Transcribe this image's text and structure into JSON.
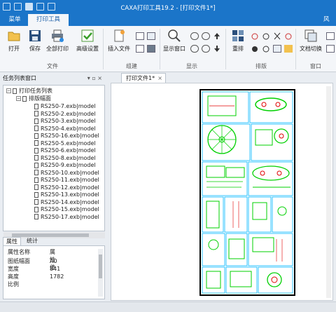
{
  "title": "CAXA打印工具19.2 - [打印文件1*]",
  "tabs": {
    "menu": "菜单",
    "print_tools": "打印工具",
    "style": "风"
  },
  "ribbon": {
    "open": "打开",
    "save": "保存",
    "print_all": "全部打印",
    "advanced": "高级设置",
    "insert_file": "插入文件",
    "show_window": "显示窗口",
    "rearrange": "重排",
    "doc_switch": "文档切换",
    "groups": {
      "file": "文件",
      "build": "组建",
      "display": "显示",
      "layout": "排版",
      "window": "窗口"
    }
  },
  "left_pane": {
    "title": "任务列表窗口",
    "pin": "▾ ▫ ×",
    "root": "打印任务列表",
    "paper": "排版幅面",
    "items": [
      "RS250-7.exb|model",
      "RS250-2.exb|model",
      "RS250-3.exb|model",
      "RS250-4.exb|model",
      "RS250-16.exb|model",
      "RS250-5.exb|model",
      "RS250-6.exb|model",
      "RS250-8.exb|model",
      "RS250-9.exb|model",
      "RS250-10.exb|model",
      "RS250-11.exb|model",
      "RS250-12.exb|model",
      "RS250-13.exb|model",
      "RS250-14.exb|model",
      "RS250-15.exb|model",
      "RS250-17.exb|model"
    ]
  },
  "prop_tabs": {
    "properties": "属性",
    "stats": "统计"
  },
  "properties": {
    "header_name": "属性名称",
    "header_value": "属性值",
    "rows": [
      {
        "name": "图纸幅面",
        "value": "A0"
      },
      {
        "name": "宽度",
        "value": "841"
      },
      {
        "name": "高度",
        "value": "1782"
      },
      {
        "name": "比例",
        "value": ""
      }
    ]
  },
  "doc_tab": {
    "label": "打印文件1*",
    "close": "×"
  },
  "colors": {
    "accent": "#1b75c9",
    "drawing_green": "#00d000",
    "drawing_cyan": "#00b8ff",
    "drawing_red": "#e00000"
  }
}
